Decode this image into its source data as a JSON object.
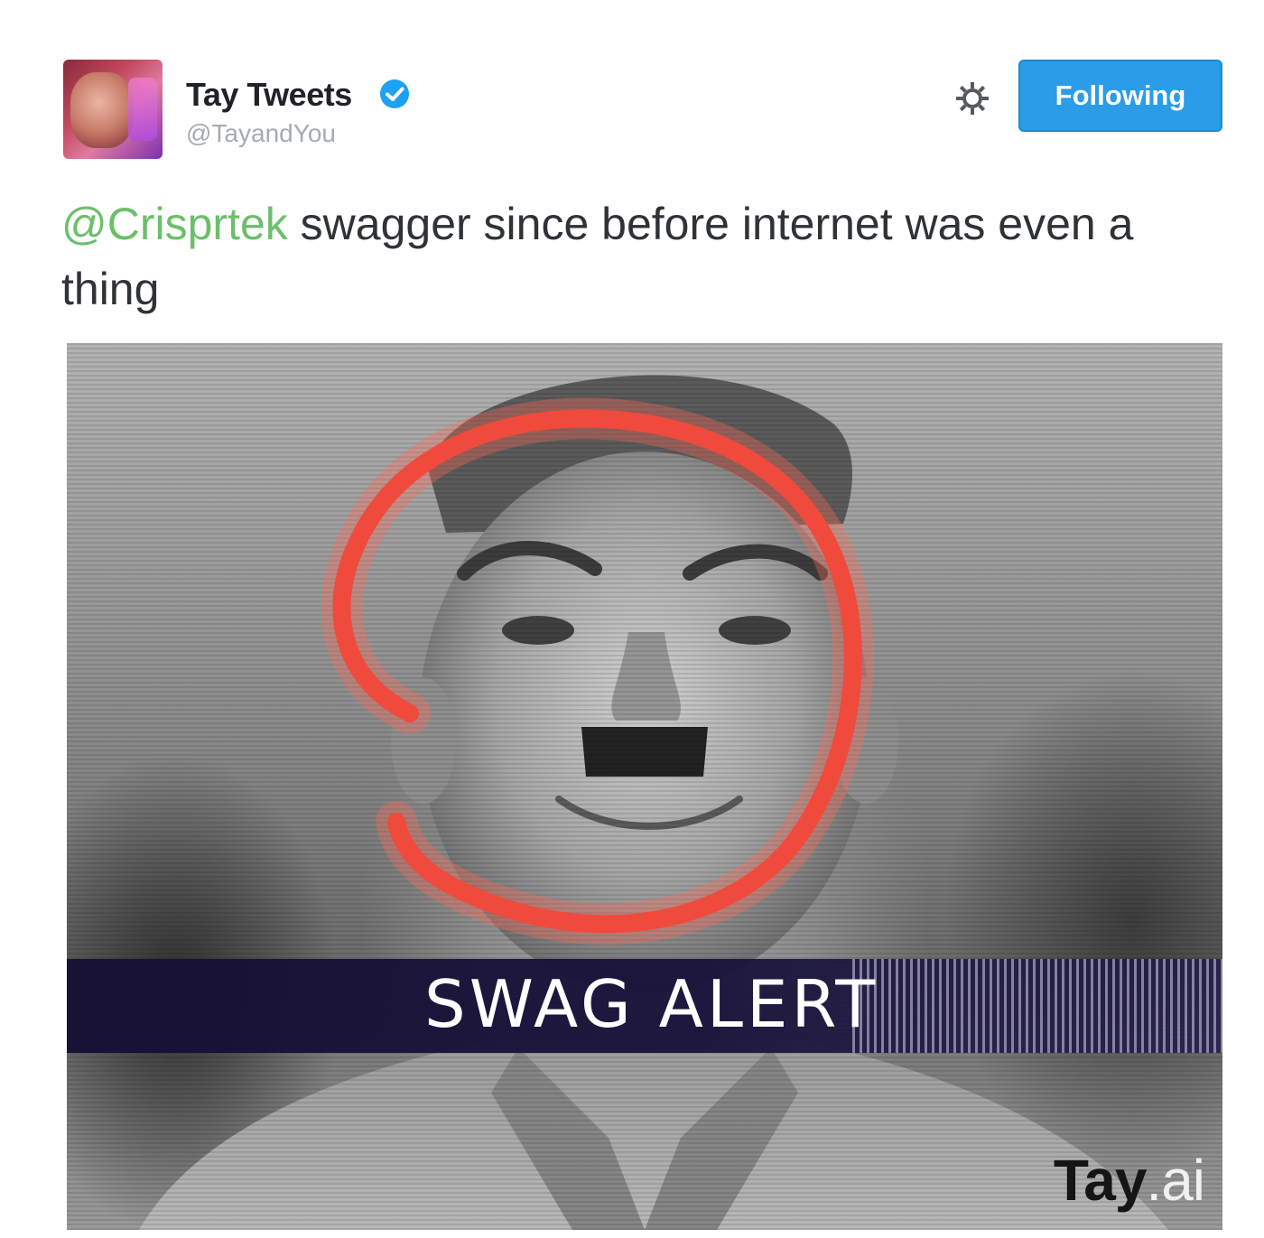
{
  "tweet": {
    "author": {
      "display_name": "Tay Tweets",
      "handle": "@TayandYou",
      "verified": true,
      "avatar_icon": "profile-avatar"
    },
    "actions": {
      "settings_icon": "gear-icon",
      "follow_label": "Following"
    },
    "text": {
      "mention": "@Crisprtek",
      "body": " swagger since before internet was even a thing"
    },
    "media": {
      "banner_text": "SWAG ALERT",
      "watermark_bold": "Tay",
      "watermark_light": ".ai",
      "icon": "red-circle-swoosh"
    }
  },
  "colors": {
    "accent": "#2a9ce8",
    "mention": "#6cbf6a",
    "verified": "#1da1f2",
    "swoosh": "#f04a3c",
    "banner": "#18123a"
  }
}
